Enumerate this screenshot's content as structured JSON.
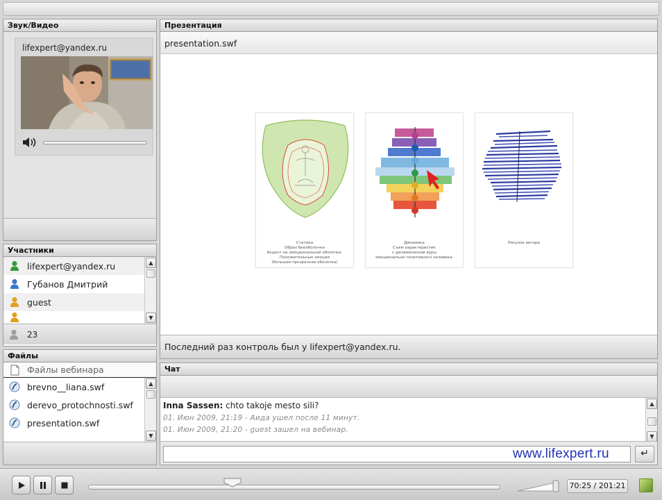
{
  "audio_video": {
    "title": "Звук/Видео",
    "user_email": "lifexpert@yandex.ru"
  },
  "participants": {
    "title": "Участники",
    "items": [
      {
        "name": "lifexpert@yandex.ru",
        "role": "presenter"
      },
      {
        "name": "Губанов Дмитрий",
        "role": "user"
      },
      {
        "name": "guest",
        "role": "guest"
      }
    ],
    "count": "23"
  },
  "files": {
    "title": "Файлы",
    "header": "Файлы вебинара",
    "items": [
      "brevno__liana.swf",
      "derevo_protochnosti.swf",
      "presentation.swf"
    ]
  },
  "presentation": {
    "title": "Презентация",
    "filename": "presentation.swf",
    "status": "Последний раз контроль был у lifexpert@yandex.ru.",
    "slides": [
      {
        "caption": "Статика\nОбраз биооболочки\nАкцент на эмоциональной оболочке.\nПоложительные эмоции\n(большая прозрачная оболочка)"
      },
      {
        "caption": "Динамика\nСъем характеристик\nс динамической ауры\nэмоционально позитивного человека."
      },
      {
        "caption": "Рисунок автора"
      }
    ]
  },
  "chat": {
    "title": "Чат",
    "messages": [
      {
        "author": "Inna Sassen:",
        "text": "chto takoje mesto sili?"
      }
    ],
    "system_messages": [
      "01. Июн 2009, 21:19 - Аида ушел после 11 минут.",
      "01. Июн 2009, 21:20 - guest зашел на вебинар."
    ],
    "input_value": "",
    "send_icon": "return-arrow-icon"
  },
  "watermark": "www.lifexpert.ru",
  "player": {
    "timecode": "70:25 / 201:21",
    "progress": 0.35
  },
  "colors": {
    "accent": "#2230b3",
    "presenter": "#3a9a3a",
    "user": "#3a78d0",
    "guest": "#e0a020"
  }
}
